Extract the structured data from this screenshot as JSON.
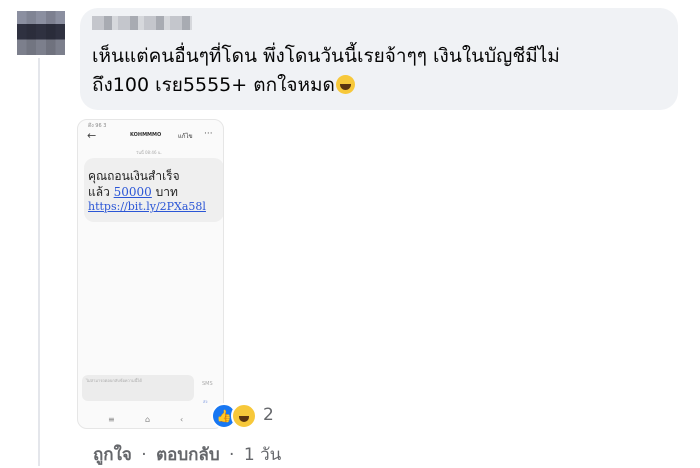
{
  "comment": {
    "text": "เห็นแต่คนอื่นๆที่โดน พึ่งโดนวันนี้เรยจ้าๆๆ เงินในบัญชีมีไม่\nถึง100 เรย5555+ ตกใจหมด",
    "emoji": "face-with-tears-of-joy-icon"
  },
  "screenshot": {
    "status_bar": "ดึง 96 3",
    "sender": "KOHMMMO",
    "edit_label": "แก้ไข",
    "date_chip": "วันนี้ 08:46 น.",
    "sms_line1": "คุณถอนเงินสำเร็จ",
    "sms_line2_prefix": "แล้ว ",
    "sms_amount": "50000",
    "sms_line2_suffix": " บาท",
    "sms_link": "https://bit.ly/2PXa58l",
    "compose_placeholder": "ไม่สามารถตอบกลับข้อความนี้ได้",
    "send_label": "SMS",
    "send_sub": "ส่ง"
  },
  "reactions": {
    "count": "2",
    "types": [
      "like",
      "haha"
    ]
  },
  "actions": {
    "like": "ถูกใจ",
    "reply": "ตอบกลับ",
    "sep": "·",
    "time": "1 วัน"
  },
  "colors": {
    "bubble": "#f0f2f5",
    "link": "#2b56d6",
    "like": "#1877f2",
    "secondary_text": "#65676b"
  }
}
